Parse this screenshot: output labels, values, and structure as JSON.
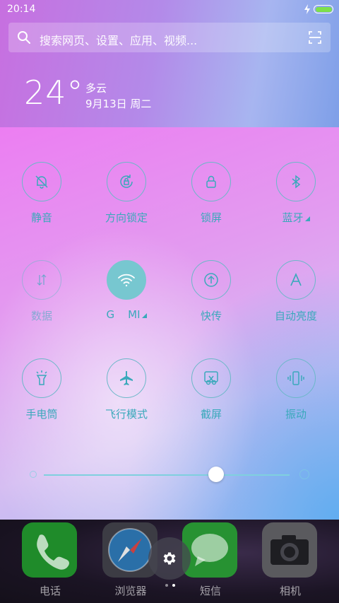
{
  "status_bar": {
    "time": "20:14",
    "battery_color": "#7ee04a"
  },
  "search": {
    "placeholder": "搜索网页、设置、应用、视频..."
  },
  "weather": {
    "temperature": "24°",
    "condition": "多云",
    "date": "9月13日 周二"
  },
  "toggles": [
    {
      "label": "静音",
      "icon": "bell-off-icon",
      "active": false
    },
    {
      "label": "方向锁定",
      "icon": "rotation-lock-icon",
      "active": false
    },
    {
      "label": "锁屏",
      "icon": "lock-icon",
      "active": false
    },
    {
      "label": "蓝牙",
      "icon": "bluetooth-icon",
      "active": false,
      "has_more": true
    },
    {
      "label": "数据",
      "icon": "mobile-data-icon",
      "active": false,
      "disabled": true
    },
    {
      "label": "G    MI",
      "icon": "wifi-icon",
      "active": true,
      "has_more": true
    },
    {
      "label": "快传",
      "icon": "transfer-icon",
      "active": false
    },
    {
      "label": "自动亮度",
      "icon": "auto-brightness-icon",
      "active": false
    },
    {
      "label": "手电筒",
      "icon": "flashlight-icon",
      "active": false
    },
    {
      "label": "飞行模式",
      "icon": "airplane-icon",
      "active": false
    },
    {
      "label": "截屏",
      "icon": "screenshot-icon",
      "active": false
    },
    {
      "label": "振动",
      "icon": "vibrate-icon",
      "active": false
    }
  ],
  "brightness": {
    "level": 0.7
  },
  "dock": {
    "apps": [
      {
        "name": "电话",
        "icon": "phone-icon"
      },
      {
        "name": "浏览器",
        "icon": "compass-icon"
      },
      {
        "name": "短信",
        "icon": "message-icon"
      },
      {
        "name": "相机",
        "icon": "camera-icon"
      }
    ],
    "page_count": 2,
    "current_page": 2
  },
  "colors": {
    "accent": "#3aa9bb",
    "active_toggle": "#77c7d0"
  }
}
